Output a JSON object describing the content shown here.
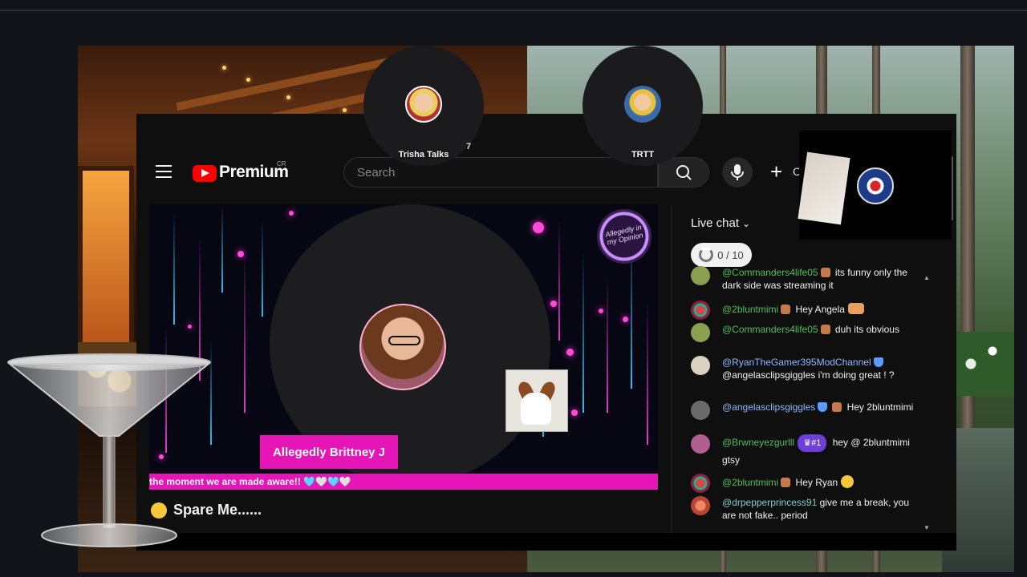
{
  "header": {
    "brand": "Premium",
    "country_code": "CR",
    "search_placeholder": "Search",
    "create_label": "C"
  },
  "guests": [
    {
      "label": "Trisha Talks",
      "extra": "7"
    },
    {
      "label": "TRTT"
    }
  ],
  "video": {
    "name_tag": "Allegedly Brittney J",
    "ticker": "the moment we are made aware!! 🩵🤍🩵🤍",
    "corner_badge": "Allegedly in my Opinion",
    "title": "Spare Me......",
    "title_emoji": "eye-roll-face-icon"
  },
  "chat": {
    "title": "Live chat",
    "goal": "0 / 10",
    "messages": [
      {
        "author": "@Commanders4life05",
        "text": "its funny only the dark side was streaming it"
      },
      {
        "author": "@2bluntmimi",
        "text": "Hey Angela"
      },
      {
        "author": "@Commanders4life05",
        "text": "duh its obvious"
      },
      {
        "author": "@RyanTheGamer395ModChannel",
        "text": "@angelasclipsgiggles i'm doing great ! ?"
      },
      {
        "author": "@angelasclipsgiggles",
        "text": "Hey 2bluntmimi"
      },
      {
        "author": "@Brwneyezgurlll",
        "member": "#1",
        "text": "hey @ 2bluntmimi gtsy"
      },
      {
        "author": "@2bluntmimi",
        "text": "Hey Ryan"
      },
      {
        "author": "@drpepperprincess91",
        "text": "give me a break, you are not fake.. period"
      }
    ]
  },
  "colors": {
    "accent_pink": "#e515b8",
    "yt_red": "#ff0000",
    "chat_author_green": "#4fbf5a"
  }
}
